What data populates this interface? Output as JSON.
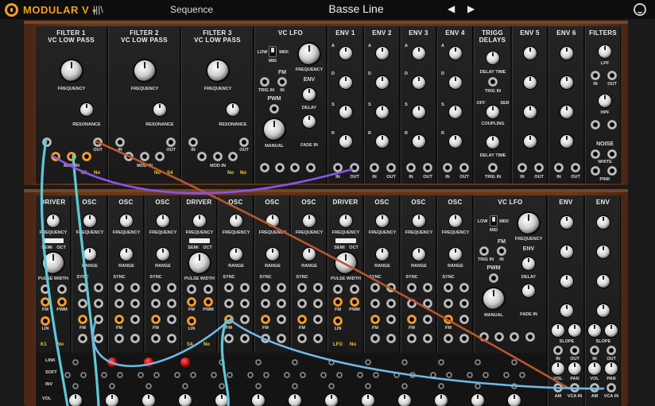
{
  "topbar": {
    "brand": "MODULAR V",
    "brand_suffix": "▾",
    "library_icon": "library-icon",
    "sequence_label": "Sequence",
    "preset_name": "Basse Line",
    "prev_icon": "◀",
    "next_icon": "▶",
    "user_icon": "user-icon",
    "accent_color": "#f0a020"
  },
  "upper_row": {
    "filter1": {
      "title": "FILTER 1",
      "subtitle": "VC LOW PASS",
      "frequency": "FREQUENCY",
      "resonance": "RESONANCE",
      "in": "IN",
      "out": "OUT",
      "mod_in": "MOD IN",
      "tag_a": "K1",
      "tag_b": "No"
    },
    "filter2": {
      "title": "FILTER 2",
      "subtitle": "VC LOW PASS",
      "frequency": "FREQUENCY",
      "resonance": "RESONANCE",
      "in": "IN",
      "out": "OUT",
      "mod_in": "MOD IN",
      "tag_a": "No",
      "tag_b": "S4"
    },
    "filter3": {
      "title": "FILTER 3",
      "subtitle": "VC LOW PASS",
      "frequency": "FREQUENCY",
      "resonance": "RESONANCE",
      "in": "IN",
      "out": "OUT",
      "mod_in": "MOD IN",
      "tag_a": "No",
      "tag_b": "No"
    },
    "vclfo": {
      "title": "VC LFO",
      "low": "LOW",
      "midi": "MIDI",
      "mid": "MID",
      "frequency": "FREQUENCY",
      "fm": "FM",
      "trig_in": "TRIG IN",
      "in": "IN",
      "pwm": "PWM",
      "manual": "MANUAL",
      "env": "ENV",
      "delay": "DELAY",
      "fade_in": "FADE IN"
    },
    "envs": [
      {
        "title": "ENV 1",
        "a": "A",
        "d": "D",
        "s": "S",
        "r": "R",
        "in": "IN",
        "out": "OUT"
      },
      {
        "title": "ENV 2",
        "a": "A",
        "d": "D",
        "s": "S",
        "r": "R",
        "in": "IN",
        "out": "OUT"
      },
      {
        "title": "ENV 3",
        "a": "A",
        "d": "D",
        "s": "S",
        "r": "R",
        "in": "IN",
        "out": "OUT"
      },
      {
        "title": "ENV 4",
        "a": "A",
        "d": "D",
        "s": "S",
        "r": "R",
        "in": "IN",
        "out": "OUT"
      }
    ],
    "trigg": {
      "title": "TRIGG",
      "subtitle": "DELAYS",
      "delay_time": "DELAY TIME",
      "trig_in": "TRIG IN",
      "off": "OFF",
      "ser": "SER",
      "par": "PAR",
      "coupling": "COUPLING",
      "delay_time2": "DELAY TIME",
      "trig_in2": "TRIG IN"
    },
    "env5": {
      "title": "ENV 5",
      "in": "IN",
      "out": "OUT"
    },
    "env6": {
      "title": "ENV 6",
      "in": "IN",
      "out": "OUT"
    },
    "filters": {
      "title": "FILTERS",
      "lpf": "LPF",
      "hpf": "HPF",
      "in": "IN",
      "out": "OUT",
      "noise": "NOISE",
      "white": "WHITE",
      "pink": "PINK"
    }
  },
  "lower_row": {
    "modules": [
      {
        "title": "DRIVER",
        "kind": "driver",
        "tag": "K1"
      },
      {
        "title": "OSC",
        "kind": "osc",
        "tag": ""
      },
      {
        "title": "OSC",
        "kind": "osc",
        "tag": ""
      },
      {
        "title": "OSC",
        "kind": "osc",
        "tag": ""
      },
      {
        "title": "DRIVER",
        "kind": "driver",
        "tag": "S4"
      },
      {
        "title": "OSC",
        "kind": "osc",
        "tag": ""
      },
      {
        "title": "OSC",
        "kind": "osc",
        "tag": ""
      },
      {
        "title": "OSC",
        "kind": "osc",
        "tag": ""
      },
      {
        "title": "DRIVER",
        "kind": "driver",
        "tag": "LFO"
      },
      {
        "title": "OSC",
        "kind": "osc",
        "tag": ""
      },
      {
        "title": "OSC",
        "kind": "osc",
        "tag": ""
      },
      {
        "title": "OSC",
        "kind": "osc",
        "tag": ""
      }
    ],
    "driver_labels": {
      "frequency": "FREQUENCY",
      "semi": "SEMI",
      "oct": "OCT",
      "pulse_width": "PULSE WIDTH",
      "fm": "FM",
      "pwm": "PWM",
      "lin": "LIN",
      "tag_b": "No"
    },
    "osc_labels": {
      "frequency": "FREQUENCY",
      "range": "RANGE",
      "sync": "SYNC",
      "fm": "FM"
    },
    "vclfo": {
      "title": "VC LFO",
      "low": "LOW",
      "midi": "MIDI",
      "mid": "MID",
      "frequency": "FREQUENCY",
      "fm": "FM",
      "trig_in": "TRIG IN",
      "in": "IN",
      "pwm": "PWM",
      "manual": "MANUAL",
      "env": "ENV",
      "delay": "DELAY",
      "fade_in": "FADE IN"
    },
    "env_a": {
      "title": "ENV",
      "slope": "SLOPE",
      "in": "IN",
      "out": "OUT",
      "vol": "VOL",
      "pan": "PAN",
      "am": "AM",
      "vca_in": "VCA IN"
    },
    "env_b": {
      "title": "ENV",
      "slope": "SLOPE",
      "in": "IN",
      "out": "OUT",
      "vol": "VOL",
      "pan": "PAN",
      "am": "AM",
      "vca_in": "VCA IN"
    },
    "sequencer": {
      "link": "LINK",
      "soft": "SOFT",
      "inv": "INV",
      "vol": "VOL"
    }
  },
  "cables": [
    {
      "name": "cable-teal-1",
      "color": "#5fc8d8"
    },
    {
      "name": "cable-teal-2",
      "color": "#5fc8d8"
    },
    {
      "name": "cable-brown",
      "color": "#b8562c"
    },
    {
      "name": "cable-purple",
      "color": "#8a55e8"
    },
    {
      "name": "cable-blue-1",
      "color": "#6fb8e8"
    },
    {
      "name": "cable-blue-2",
      "color": "#6fb8e8"
    },
    {
      "name": "cable-teal-3",
      "color": "#5fc8d8"
    }
  ]
}
